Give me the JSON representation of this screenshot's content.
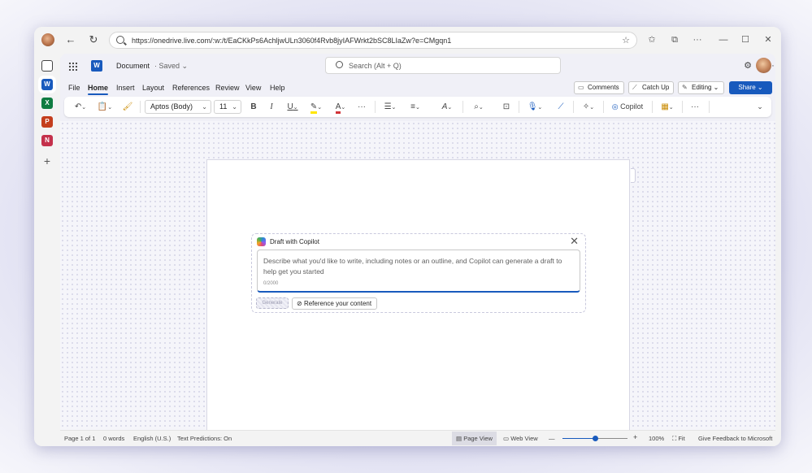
{
  "browser": {
    "url": "https://onedrive.live.com/:w:/t/EaCKkPs6AchljwULn3060f4Rvb8jyIAFWrkt2bSC8LIaZw?e=CMgqn1",
    "icons": [
      "back-arrow",
      "refresh",
      "star",
      "favorites",
      "collections",
      "minimize",
      "maximize",
      "close"
    ],
    "window_controls": {
      "minimize": "—",
      "maximize": "☐",
      "close": "✕"
    }
  },
  "rail": {
    "apps": [
      "OneDrive",
      "Word",
      "Excel",
      "PowerPoint",
      "OneNote",
      "Add"
    ],
    "colors": {
      "word": "#185abd",
      "excel": "#107c41",
      "powerpoint": "#c43e1c",
      "onenote": "#7719aa"
    }
  },
  "app": {
    "logo": "W",
    "doc_name": "Document",
    "doc_status": "· Saved ⌄",
    "search_placeholder": "Search (Alt + Q)",
    "more": "···"
  },
  "tabs": [
    "File",
    "Home",
    "Insert",
    "Layout",
    "References",
    "Review",
    "View",
    "Help"
  ],
  "actions": {
    "comments": "Comments",
    "catch_up": "Catch Up",
    "editing": "Editing ⌄",
    "share": "Share ⌄"
  },
  "ribbon": {
    "font_name": "Aptos (Body)",
    "font_size": "11",
    "bold": "B",
    "italic": "I",
    "underline": "U",
    "font_color": "A",
    "more": "···",
    "copilot": "Copilot",
    "chevron": "⌄"
  },
  "copilot_panel": {
    "title": "Draft with Copilot",
    "placeholder": "Describe what you'd like to write, including notes or an outline, and Copilot can generate a draft to help get you started",
    "char_count": "0/2000",
    "generate": "Generate",
    "reference": "Reference your content",
    "close": "✕"
  },
  "status": {
    "page": "Page 1 of 1",
    "words": "0 words",
    "language": "English (U.S.)",
    "predictions": "Text Predictions: On",
    "page_view": "Page View",
    "web_view": "Web View",
    "zoom_minus": "—",
    "zoom_plus": "+",
    "zoom": "100%",
    "zoom_level": 0.5,
    "fit": "Fit",
    "feedback": "Give Feedback to Microsoft"
  },
  "colors": {
    "accent": "#185abd",
    "highlight": "#ffe600",
    "font_red": "#d13438"
  }
}
